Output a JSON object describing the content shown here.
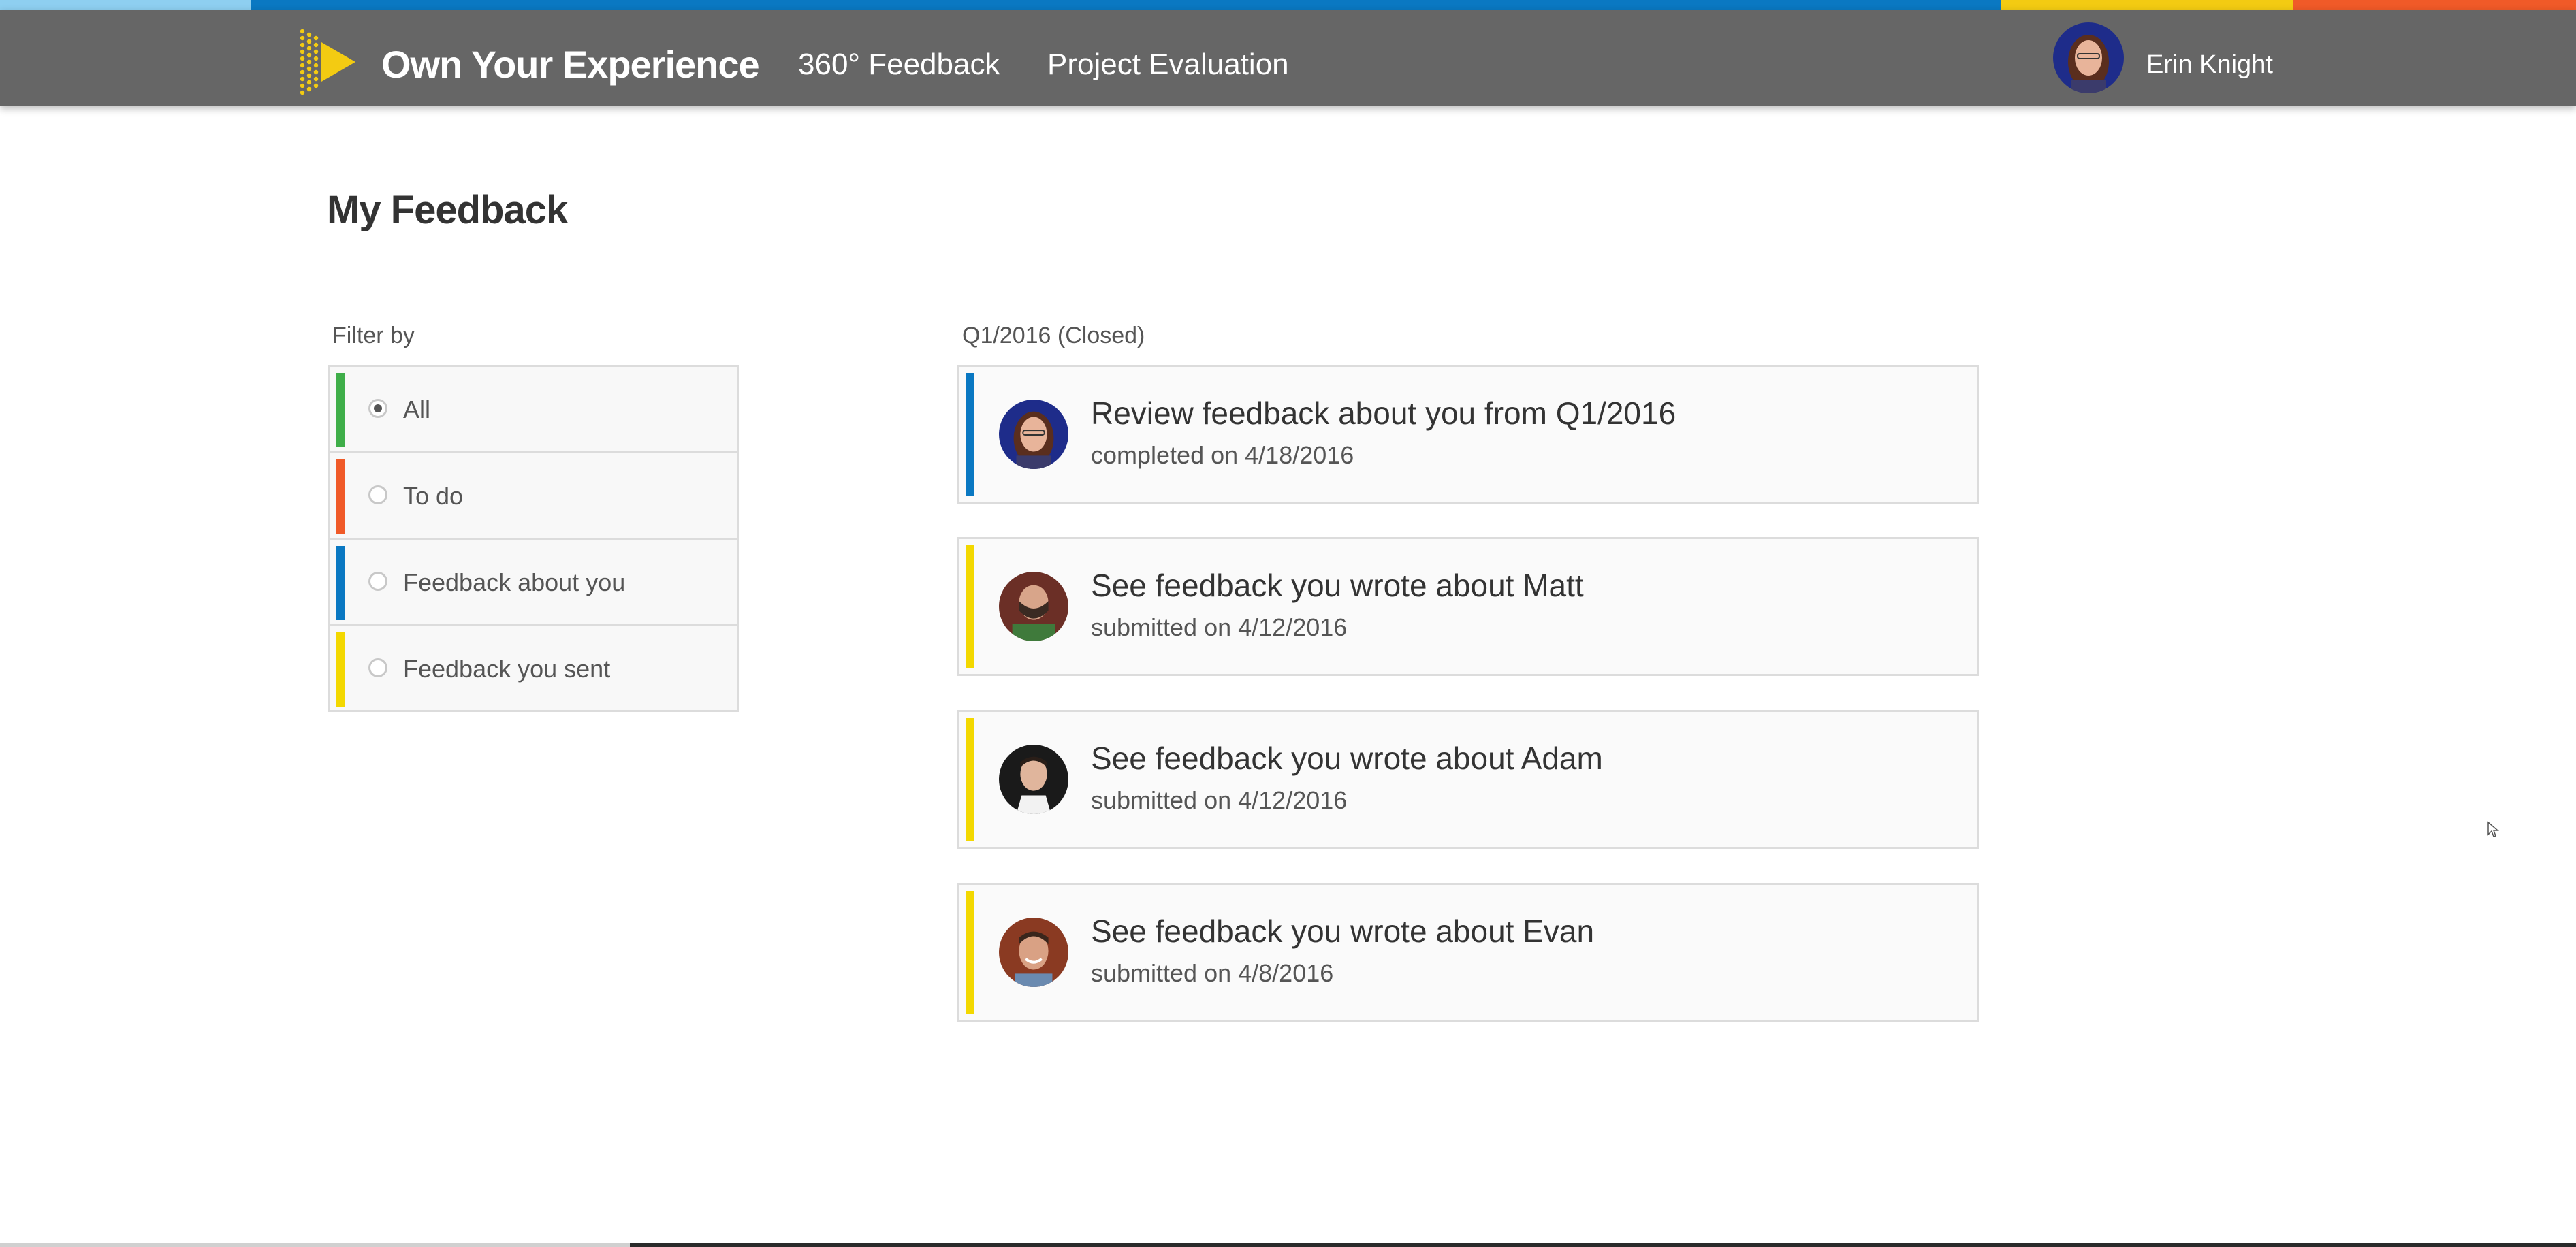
{
  "colors": {
    "strip": [
      "#8ecff0",
      "#0a78c2",
      "#f3cb12",
      "#f05a28"
    ],
    "header_bg": "#666666",
    "filter_bars": [
      "#3fae49",
      "#f05a28",
      "#0a78c2",
      "#f3d800"
    ],
    "card_bars": [
      "#0a78c2",
      "#f3d800",
      "#f3d800",
      "#f3d800"
    ]
  },
  "header": {
    "brand": "Own Your Experience",
    "logo_icon": "play-arrow-dots-icon",
    "nav": [
      "360° Feedback",
      "Project Evaluation"
    ],
    "user_name": "Erin Knight"
  },
  "page": {
    "title": "My Feedback"
  },
  "filter": {
    "label": "Filter by",
    "options": [
      {
        "label": "All",
        "checked": true
      },
      {
        "label": "To do",
        "checked": false
      },
      {
        "label": "Feedback about you",
        "checked": false
      },
      {
        "label": "Feedback you sent",
        "checked": false
      }
    ]
  },
  "feed": {
    "section_label": "Q1/2016 (Closed)",
    "items": [
      {
        "title": "Review feedback about you from Q1/2016",
        "subtitle": "completed on 4/18/2016"
      },
      {
        "title": "See feedback you wrote about Matt",
        "subtitle": "submitted on 4/12/2016"
      },
      {
        "title": "See feedback you wrote about Adam",
        "subtitle": "submitted on 4/12/2016"
      },
      {
        "title": "See feedback you wrote about Evan",
        "subtitle": "submitted on 4/8/2016"
      }
    ]
  }
}
